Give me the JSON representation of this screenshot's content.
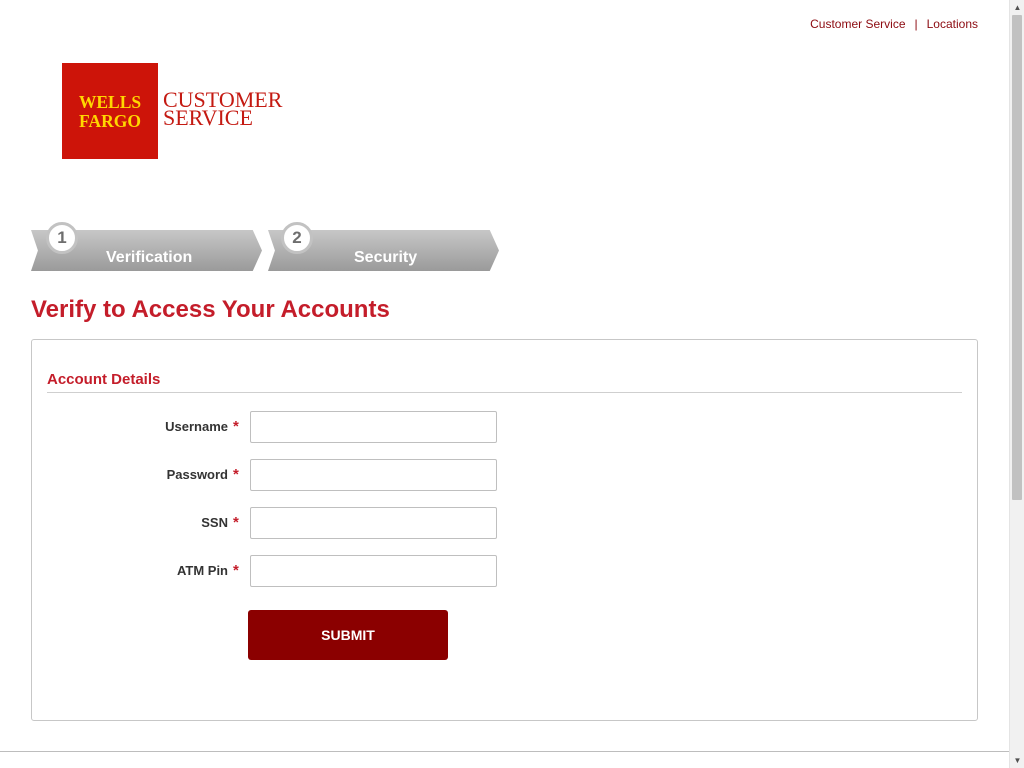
{
  "topnav": {
    "customer_service": "Customer Service",
    "separator": "|",
    "locations": "Locations"
  },
  "logo": {
    "line1": "WELLS",
    "line2": "FARGO",
    "tag_line1": "CUSTOMER",
    "tag_line2": "SERVICE",
    "brand_red": "#cd1409",
    "brand_gold": "#ffd700"
  },
  "steps": [
    {
      "number": "1",
      "label": "Verification"
    },
    {
      "number": "2",
      "label": "Security"
    }
  ],
  "page_title": "Verify to Access Your Accounts",
  "form": {
    "section_title": "Account Details",
    "required_marker": "*",
    "fields": [
      {
        "label": "Username",
        "value": ""
      },
      {
        "label": "Password",
        "value": ""
      },
      {
        "label": "SSN",
        "value": ""
      },
      {
        "label": "ATM Pin",
        "value": ""
      }
    ],
    "submit_label": "SUBMIT",
    "accent_color": "#c41d2a",
    "button_color": "#8b0000"
  },
  "scrollbar": {
    "up_arrow": "▲",
    "down_arrow": "▼"
  }
}
